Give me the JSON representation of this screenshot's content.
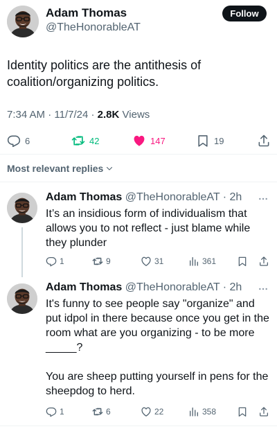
{
  "post": {
    "author_name": "Adam Thomas",
    "author_handle": "@TheHonorableAT",
    "follow_label": "Follow",
    "text": "Identity politics are the antithesis of coalition/organizing politics.",
    "time": "7:34 AM",
    "date": "11/7/24",
    "views_count": "2.8K",
    "views_label": "Views",
    "replies": "6",
    "reposts": "42",
    "likes": "147",
    "bookmarks": "19",
    "liked": true,
    "colors": {
      "repost": "#00ba7c",
      "like": "#f91880",
      "text": "#0f1419",
      "muted": "#536471"
    }
  },
  "sort_label": "Most relevant replies",
  "replies": [
    {
      "name": "Adam Thomas",
      "handle": "@TheHonorableAT",
      "time": "2h",
      "text": "It’s an insidious form of individualism that allows you to not reflect - just blame while they plunder",
      "replies": "1",
      "reposts": "9",
      "likes": "31",
      "views": "361"
    },
    {
      "name": "Adam Thomas",
      "handle": "@TheHonorableAT",
      "time": "2h",
      "text": "It's funny to see people say \"organize\" and put idpol in there because once you get in the room what are you organizing - to be more _____?\n\nYou are sheep putting yourself in pens for the sheepdog to herd.",
      "replies": "1",
      "reposts": "6",
      "likes": "22",
      "views": "358"
    }
  ],
  "icons": [
    "reply-icon",
    "repost-icon",
    "like-icon",
    "bookmark-icon",
    "share-icon",
    "views-icon",
    "more-icon",
    "chevron-down-icon"
  ]
}
